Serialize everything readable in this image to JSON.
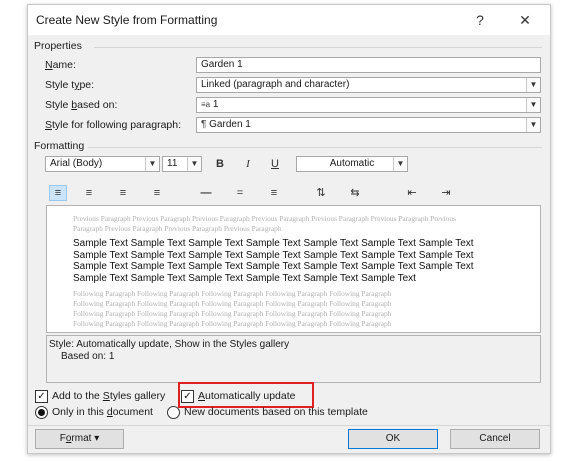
{
  "dialog": {
    "title": "Create New Style from Formatting",
    "help": "?",
    "close": "✕"
  },
  "properties": {
    "heading": "Properties",
    "name_label": "Name:",
    "name_value": "Garden 1",
    "type_label": "Style type:",
    "type_value": "Linked (paragraph and character)",
    "based_label": "Style based on:",
    "based_value": "1",
    "following_label": "Style for following paragraph:",
    "following_value": "Garden 1"
  },
  "formatting": {
    "heading": "Formatting",
    "font": "Arial (Body)",
    "size": "11",
    "bold": "B",
    "italic": "I",
    "underline": "U",
    "color": "Automatic"
  },
  "preview": {
    "previous": "Previous Paragraph Previous Paragraph Previous Paragraph Previous Paragraph Previous Paragraph Previous Paragraph Previous Paragraph Previous Paragraph Previous Paragraph Previous Paragraph",
    "sample": "Sample Text Sample Text Sample Text Sample Text Sample Text Sample Text Sample Text Sample Text Sample Text Sample Text Sample Text Sample Text Sample Text Sample Text Sample Text Sample Text Sample Text Sample Text Sample Text Sample Text Sample Text Sample Text Sample Text Sample Text Sample Text Sample Text Sample Text",
    "following_1": "Following Paragraph Following Paragraph Following Paragraph Following Paragraph Following Paragraph",
    "following_2": "Following Paragraph Following Paragraph Following Paragraph Following Paragraph Following Paragraph",
    "following_3": "Following Paragraph Following Paragraph Following Paragraph Following Paragraph Following Paragraph",
    "following_4": "Following Paragraph Following Paragraph Following Paragraph Following Paragraph Following Paragraph",
    "following_5": "Following Paragraph Following Paragraph Following Paragraph Following Paragraph Following Paragraph"
  },
  "description": {
    "line1": "Style: Automatically update, Show in the Styles gallery",
    "line2": "Based on: 1"
  },
  "options": {
    "add_gallery": "Add to the Styles gallery",
    "add_gallery_checked": true,
    "auto_update": "Automatically update",
    "auto_update_checked": true,
    "only_doc": "Only in this document",
    "new_docs": "New documents based on this template"
  },
  "buttons": {
    "format": "Format",
    "ok": "OK",
    "cancel": "Cancel"
  },
  "colors": {
    "highlight": "#e02020",
    "selected_tool": "#cce4f7",
    "default_button_border": "#0078d7"
  }
}
